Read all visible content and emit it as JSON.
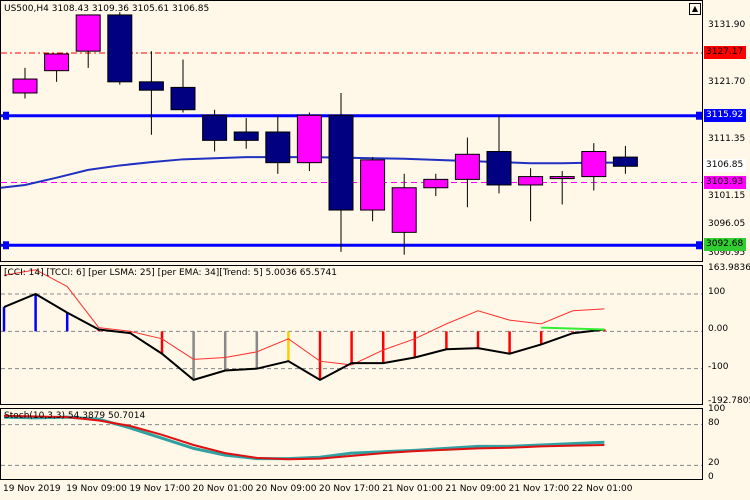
{
  "header": {
    "symbol": "US500,H4",
    "open": "3108.43",
    "high": "3109.36",
    "low": "3105.61",
    "close": "3106.85"
  },
  "price_axis": {
    "ticks": [
      "3131.90",
      "3121.70",
      "3111.35",
      "3101.15",
      "3096.05",
      "3090.95"
    ],
    "tags": [
      {
        "text": "3127.17",
        "bg": "#ff0000",
        "fg": "#000000"
      },
      {
        "text": "3115.92",
        "bg": "#0000ff",
        "fg": "#ffffff"
      },
      {
        "text": "3106.85",
        "bg": "#ffffff",
        "fg": "#000000"
      },
      {
        "text": "3103.93",
        "bg": "#ff00ff",
        "fg": "#000000"
      },
      {
        "text": "3092.68",
        "bg": "#33cc33",
        "fg": "#000000"
      }
    ]
  },
  "cci_panel": {
    "label": "[CCI: 14] [TCCI: 6] [per LSMA: 25] [per EMA: 34][Trend: 5]  5.0036 65.5741",
    "ticks": [
      "163.9836",
      "100",
      "0.00",
      "-100",
      "-192.7805"
    ]
  },
  "stoch_panel": {
    "label": "Stoch(10,3,3) 54.3879 50.7014",
    "ticks": [
      "100",
      "80",
      "20",
      "0"
    ]
  },
  "time_axis": [
    "19 Nov 2019",
    "19 Nov 09:00",
    "19 Nov 17:00",
    "20 Nov 01:00",
    "20 Nov 09:00",
    "20 Nov 17:00",
    "21 Nov 01:00",
    "21 Nov 09:00",
    "21 Nov 17:00",
    "22 Nov 01:00"
  ],
  "chart_data": {
    "type": "candlestick",
    "candles": [
      {
        "o": 3120.0,
        "h": 3124.5,
        "l": 3119.0,
        "c": 3122.5
      },
      {
        "o": 3124.0,
        "h": 3125.5,
        "l": 3122.0,
        "c": 3127.0
      },
      {
        "o": 3127.5,
        "h": 3134.0,
        "l": 3124.5,
        "c": 3134.0
      },
      {
        "o": 3134.0,
        "h": 3134.5,
        "l": 3121.5,
        "c": 3122.0
      },
      {
        "o": 3122.0,
        "h": 3127.5,
        "l": 3112.5,
        "c": 3120.5
      },
      {
        "o": 3121.0,
        "h": 3126.0,
        "l": 3116.5,
        "c": 3117.0
      },
      {
        "o": 3116.0,
        "h": 3117.0,
        "l": 3109.5,
        "c": 3111.5
      },
      {
        "o": 3113.0,
        "h": 3115.5,
        "l": 3110.0,
        "c": 3111.5
      },
      {
        "o": 3113.0,
        "h": 3116.0,
        "l": 3105.5,
        "c": 3107.5
      },
      {
        "o": 3107.5,
        "h": 3116.5,
        "l": 3106.0,
        "c": 3116.0
      },
      {
        "o": 3116.0,
        "h": 3120.0,
        "l": 3091.5,
        "c": 3099.0
      },
      {
        "o": 3099.0,
        "h": 3108.5,
        "l": 3097.0,
        "c": 3108.0
      },
      {
        "o": 3095.0,
        "h": 3105.5,
        "l": 3091.0,
        "c": 3103.0
      },
      {
        "o": 3103.0,
        "h": 3105.5,
        "l": 3101.5,
        "c": 3104.5
      },
      {
        "o": 3104.5,
        "h": 3112.0,
        "l": 3099.5,
        "c": 3109.0
      },
      {
        "o": 3109.5,
        "h": 3116.0,
        "l": 3102.0,
        "c": 3103.5
      },
      {
        "o": 3103.5,
        "h": 3106.5,
        "l": 3097.0,
        "c": 3105.0
      },
      {
        "o": 3105.0,
        "h": 3106.0,
        "l": 3100.0,
        "c": 3105.0
      },
      {
        "o": 3105.0,
        "h": 3111.0,
        "l": 3102.5,
        "c": 3109.5
      },
      {
        "o": 3108.5,
        "h": 3110.5,
        "l": 3105.5,
        "c": 3106.85
      }
    ],
    "ma": [
      3103.5,
      3104.8,
      3106.2,
      3107.0,
      3107.6,
      3108.1,
      3108.3,
      3108.5,
      3108.5,
      3108.5,
      3108.4,
      3108.3,
      3108.2,
      3108.0,
      3107.8,
      3107.6,
      3107.4,
      3107.4,
      3107.5,
      3107.5
    ],
    "hlines": [
      {
        "price": 3127.17,
        "color": "#ff0000",
        "style": "dashdot"
      },
      {
        "price": 3115.92,
        "color": "#0000ff",
        "style": "solid"
      },
      {
        "price": 3103.93,
        "color": "#ff00ff",
        "style": "dash"
      },
      {
        "price": 3092.68,
        "color": "#0000ff",
        "style": "solid"
      }
    ],
    "cci": [
      65,
      100,
      50,
      5,
      -5,
      -60,
      -130,
      -105,
      -100,
      -80,
      -130,
      -85,
      -85,
      -70,
      -48,
      -45,
      -60,
      -35,
      -5,
      5
    ],
    "tcci": [
      150,
      165,
      120,
      10,
      0,
      -20,
      -75,
      -70,
      -55,
      -20,
      -80,
      -90,
      -50,
      -20,
      20,
      55,
      30,
      20,
      55,
      60
    ],
    "stoch_main": [
      91,
      90,
      91,
      88,
      75,
      60,
      45,
      35,
      30,
      30,
      32,
      38,
      40,
      42,
      45,
      48,
      48,
      50,
      52,
      54
    ],
    "stoch_signal": [
      93,
      92,
      91,
      86,
      78,
      65,
      50,
      38,
      31,
      29,
      30,
      34,
      38,
      41,
      43,
      45,
      46,
      48,
      49,
      50
    ]
  }
}
